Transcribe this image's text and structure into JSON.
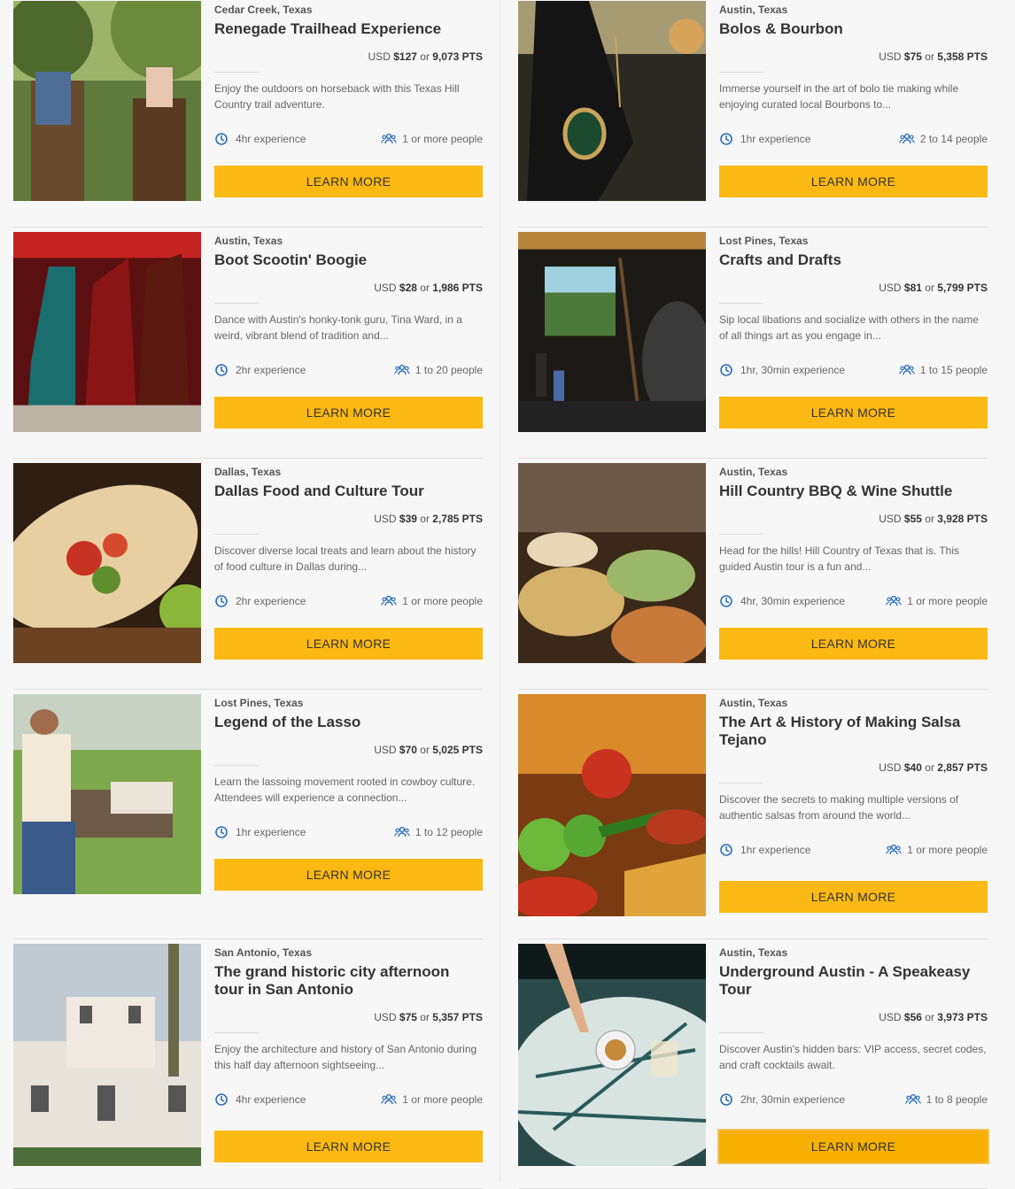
{
  "button_label": "LEARN MORE",
  "accent": "#fdb913",
  "icon_color": "#2a6ebb",
  "left": [
    {
      "location": "Cedar Creek, Texas",
      "title": "Renegade Trailhead Experience",
      "currency": "USD",
      "price": "$127",
      "or": "or",
      "points": "9,073",
      "pts": "PTS",
      "desc": "Enjoy the outdoors on horseback with this Texas Hill Country trail adventure.",
      "duration": "4hr experience",
      "people": "1 or more people",
      "image": "horseback riders on trail"
    },
    {
      "location": "Austin, Texas",
      "title": "Boot Scootin' Boogie",
      "currency": "USD",
      "price": "$28",
      "or": "or",
      "points": "1,986",
      "pts": "PTS",
      "desc": "Dance with Austin's honky-tonk guru, Tina Ward, in a weird, vibrant blend of tradition and...",
      "duration": "2hr experience",
      "people": "1 to 20 people",
      "image": "cowboy boots on display"
    },
    {
      "location": "Dallas, Texas",
      "title": "Dallas Food and Culture Tour",
      "currency": "USD",
      "price": "$39",
      "or": "or",
      "points": "2,785",
      "pts": "PTS",
      "desc": "Discover diverse local treats and learn about the history of food culture in Dallas during...",
      "duration": "2hr experience",
      "people": "1 or more people",
      "image": "burrito with lime"
    },
    {
      "location": "Lost Pines, Texas",
      "title": "Legend of the Lasso",
      "currency": "USD",
      "price": "$70",
      "or": "or",
      "points": "5,025",
      "pts": "PTS",
      "desc": "Learn the lassoing movement rooted in cowboy culture. Attendees will experience a connection...",
      "duration": "1hr experience",
      "people": "1 to 12 people",
      "image": "woman lassoing longhorn"
    },
    {
      "location": "San Antonio, Texas",
      "title": "The grand historic city afternoon tour in San Antonio",
      "currency": "USD",
      "price": "$75",
      "or": "or",
      "points": "5,357",
      "pts": "PTS",
      "desc": "Enjoy the architecture and history of San Antonio during this half day afternoon sightseeing...",
      "duration": "4hr experience",
      "people": "1 or more people",
      "image": "historic white building"
    }
  ],
  "right": [
    {
      "location": "Austin, Texas",
      "title": "Bolos & Bourbon",
      "currency": "USD",
      "price": "$75",
      "or": "or",
      "points": "5,358",
      "pts": "PTS",
      "desc": "Immerse yourself in the art of bolo tie making while enjoying curated local Bourbons to...",
      "duration": "1hr experience",
      "people": "2 to 14 people",
      "image": "bolo tie"
    },
    {
      "location": "Lost Pines, Texas",
      "title": "Crafts and Drafts",
      "currency": "USD",
      "price": "$81",
      "or": "or",
      "points": "5,799",
      "pts": "PTS",
      "desc": "Sip local libations and socialize with others in the name of all things art as you engage in...",
      "duration": "1hr, 30min experience",
      "people": "1 to 15 people",
      "image": "woman painting on easel"
    },
    {
      "location": "Austin, Texas",
      "title": "Hill Country BBQ & Wine Shuttle",
      "currency": "USD",
      "price": "$55",
      "or": "or",
      "points": "3,928",
      "pts": "PTS",
      "desc": "Head for the hills! Hill Country of Texas that is. This guided Austin tour is a fun and...",
      "duration": "4hr, 30min experience",
      "people": "1 or more people",
      "image": "bbq plates"
    },
    {
      "location": "Austin, Texas",
      "title": "The Art & History of Making Salsa Tejano",
      "currency": "USD",
      "price": "$40",
      "or": "or",
      "points": "2,857",
      "pts": "PTS",
      "desc": "Discover the secrets to making multiple versions of authentic salsas from around the world...",
      "duration": "1hr experience",
      "people": "1 or more people",
      "image": "tomatoes and peppers"
    },
    {
      "location": "Austin, Texas",
      "title": "Underground Austin - A Speakeasy Tour",
      "currency": "USD",
      "price": "$56",
      "or": "or",
      "points": "3,973",
      "pts": "PTS",
      "desc": "Discover Austin's hidden bars: VIP access, secret codes, and craft cocktails await.",
      "duration": "2hr, 30min experience",
      "people": "1 to 8 people",
      "image": "cocktails on mosaic table"
    }
  ]
}
